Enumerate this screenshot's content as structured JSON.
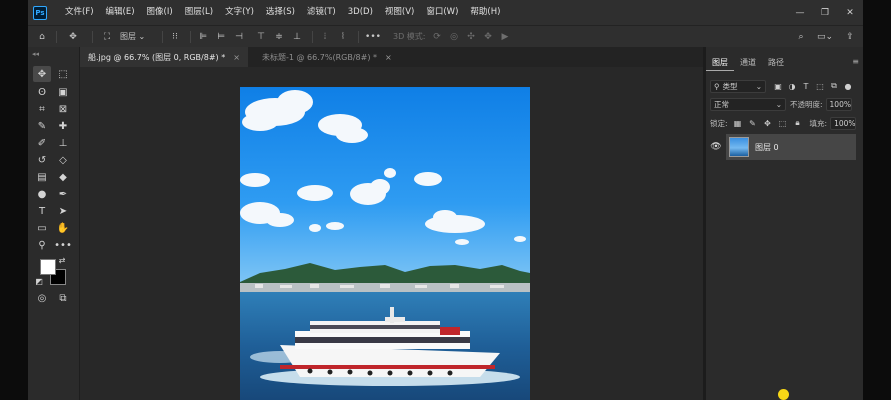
{
  "app": {
    "logo_text": "Ps",
    "brand_color": "#31a8ff"
  },
  "menu": [
    "文件(F)",
    "编辑(E)",
    "图像(I)",
    "图层(L)",
    "文字(Y)",
    "选择(S)",
    "滤镜(T)",
    "3D(D)",
    "视图(V)",
    "窗口(W)",
    "帮助(H)"
  ],
  "window_controls": {
    "minimize": "—",
    "restore": "❐",
    "close": "✕"
  },
  "options_bar": {
    "home_icon": "⌂",
    "move_icon": "✥",
    "auto_select_icon": "⛶",
    "layer_dropdown": "图层",
    "more": "•••",
    "mode_3d_label": "3D 模式:",
    "search_icon": "⌕",
    "share_icon": "⇪"
  },
  "tabs": [
    {
      "label": "船.jpg @ 66.7% (图层 0, RGB/8#) *",
      "active": true,
      "close": "×"
    },
    {
      "label": "未标题-1 @ 66.7%(RGB/8#) *",
      "active": false,
      "close": "×"
    }
  ],
  "toolbar": {
    "collapse": "◂◂",
    "tools": [
      {
        "name": "move-tool",
        "glyph": "✥"
      },
      {
        "name": "marquee-tool",
        "glyph": "⬚"
      },
      {
        "name": "lasso-tool",
        "glyph": "ʘ"
      },
      {
        "name": "object-select-tool",
        "glyph": "▣"
      },
      {
        "name": "crop-tool",
        "glyph": "⌗"
      },
      {
        "name": "frame-tool",
        "glyph": "⊠"
      },
      {
        "name": "eyedropper-tool",
        "glyph": "✎"
      },
      {
        "name": "spot-healing-tool",
        "glyph": "✚"
      },
      {
        "name": "brush-tool",
        "glyph": "✐"
      },
      {
        "name": "stamp-tool",
        "glyph": "⊥"
      },
      {
        "name": "history-brush-tool",
        "glyph": "↺"
      },
      {
        "name": "eraser-tool",
        "glyph": "◇"
      },
      {
        "name": "gradient-tool",
        "glyph": "▤"
      },
      {
        "name": "blur-tool",
        "glyph": "◆"
      },
      {
        "name": "dodge-tool",
        "glyph": "●"
      },
      {
        "name": "pen-tool",
        "glyph": "✒"
      },
      {
        "name": "type-tool",
        "glyph": "T"
      },
      {
        "name": "path-select-tool",
        "glyph": "➤"
      },
      {
        "name": "shape-tool",
        "glyph": "▭"
      },
      {
        "name": "hand-tool",
        "glyph": "✋"
      },
      {
        "name": "zoom-tool",
        "glyph": "⚲"
      },
      {
        "name": "more-tools",
        "glyph": "•••"
      }
    ],
    "swap_icon": "⇄",
    "default_colors_icon": "◩",
    "quick_mask_icon": "◎",
    "screen_mode_icon": "⧉",
    "foreground_color": "#ffffff",
    "background_color": "#000000"
  },
  "layers_panel": {
    "tabs": [
      "图层",
      "通道",
      "路径"
    ],
    "menu_icon": "≡",
    "filter_kind": "类型",
    "blend_mode": "正常",
    "opacity_label": "不透明度:",
    "opacity_value": "100%",
    "lock_label": "锁定:",
    "fill_label": "填充:",
    "fill_value": "100%",
    "layers": [
      {
        "name": "图层 0",
        "visible": true
      }
    ]
  }
}
